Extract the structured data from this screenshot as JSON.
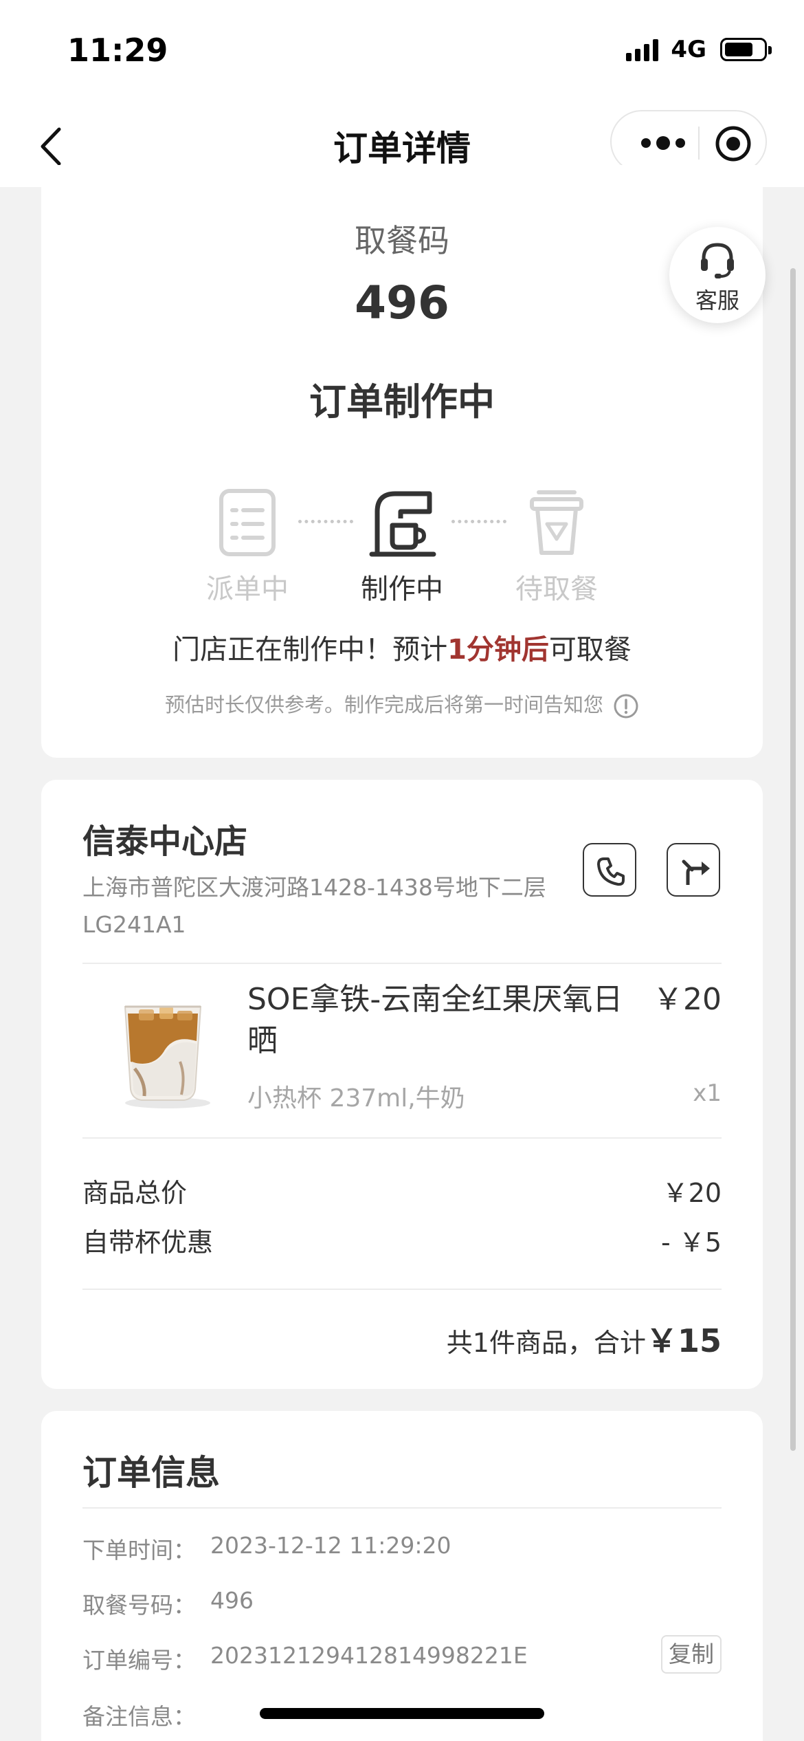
{
  "status_bar": {
    "time": "11:29",
    "network": "4G"
  },
  "nav": {
    "title": "订单详情"
  },
  "pickup": {
    "label": "取餐码",
    "code": "496",
    "status": "订单制作中",
    "steps": [
      {
        "label": "派单中",
        "icon": "clipboard-icon",
        "active": false
      },
      {
        "label": "制作中",
        "icon": "coffee-machine-icon",
        "active": true
      },
      {
        "label": "待取餐",
        "icon": "cup-icon",
        "active": false
      }
    ],
    "message_prefix": "门店正在制作中！预计",
    "message_highlight": "1分钟后",
    "message_suffix": "可取餐",
    "highlight_color": "#a13530",
    "disclaimer": "预估时长仅供参考。制作完成后将第一时间告知您"
  },
  "customer_service": {
    "label": "客服"
  },
  "store": {
    "name": "信泰中心店",
    "address": "上海市普陀区大渡河路1428-1438号地下二层LG241A1"
  },
  "product": {
    "name": "SOE拿铁-云南全红果厌氧日晒",
    "price": "￥20",
    "spec": "小热杯 237ml,牛奶",
    "qty": "x1"
  },
  "summary": {
    "subtotal_label": "商品总价",
    "subtotal_value": "￥20",
    "discount_label": "自带杯优惠",
    "discount_value": "- ￥5",
    "total_prefix": "共1件商品，合计",
    "total_amount": "￥15"
  },
  "order_info": {
    "title": "订单信息",
    "rows": [
      {
        "label": "下单时间：",
        "value": "2023-12-12 11:29:20"
      },
      {
        "label": "取餐号码：",
        "value": "496"
      },
      {
        "label": "订单编号：",
        "value": "20231212941281499822​1E"
      },
      {
        "label": "备注信息：",
        "value": ""
      }
    ],
    "copy_label": "复制"
  }
}
